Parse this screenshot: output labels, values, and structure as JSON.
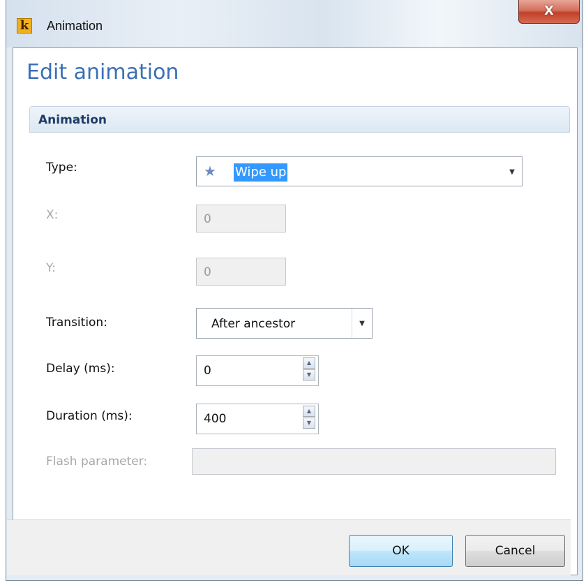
{
  "window": {
    "title": "Animation",
    "app_icon_glyph": "k",
    "close_glyph": "X"
  },
  "header": {
    "title": "Edit animation"
  },
  "section": {
    "title": "Animation"
  },
  "form": {
    "type": {
      "label": "Type:",
      "value": "Wipe up",
      "icon": "star-icon"
    },
    "x": {
      "label": "X:",
      "value": "0",
      "disabled": true
    },
    "y": {
      "label": "Y:",
      "value": "0",
      "disabled": true
    },
    "transition": {
      "label": "Transition:",
      "value": "After ancestor"
    },
    "delay": {
      "label": "Delay (ms):",
      "value": "0"
    },
    "duration": {
      "label": "Duration (ms):",
      "value": "400"
    },
    "flash": {
      "label": "Flash parameter:",
      "value": "",
      "disabled": true
    }
  },
  "buttons": {
    "ok_label": "OK",
    "cancel_label": "Cancel"
  },
  "colors": {
    "accent": "#3a6fb6",
    "selection": "#3399ff",
    "close": "#c2402a"
  }
}
